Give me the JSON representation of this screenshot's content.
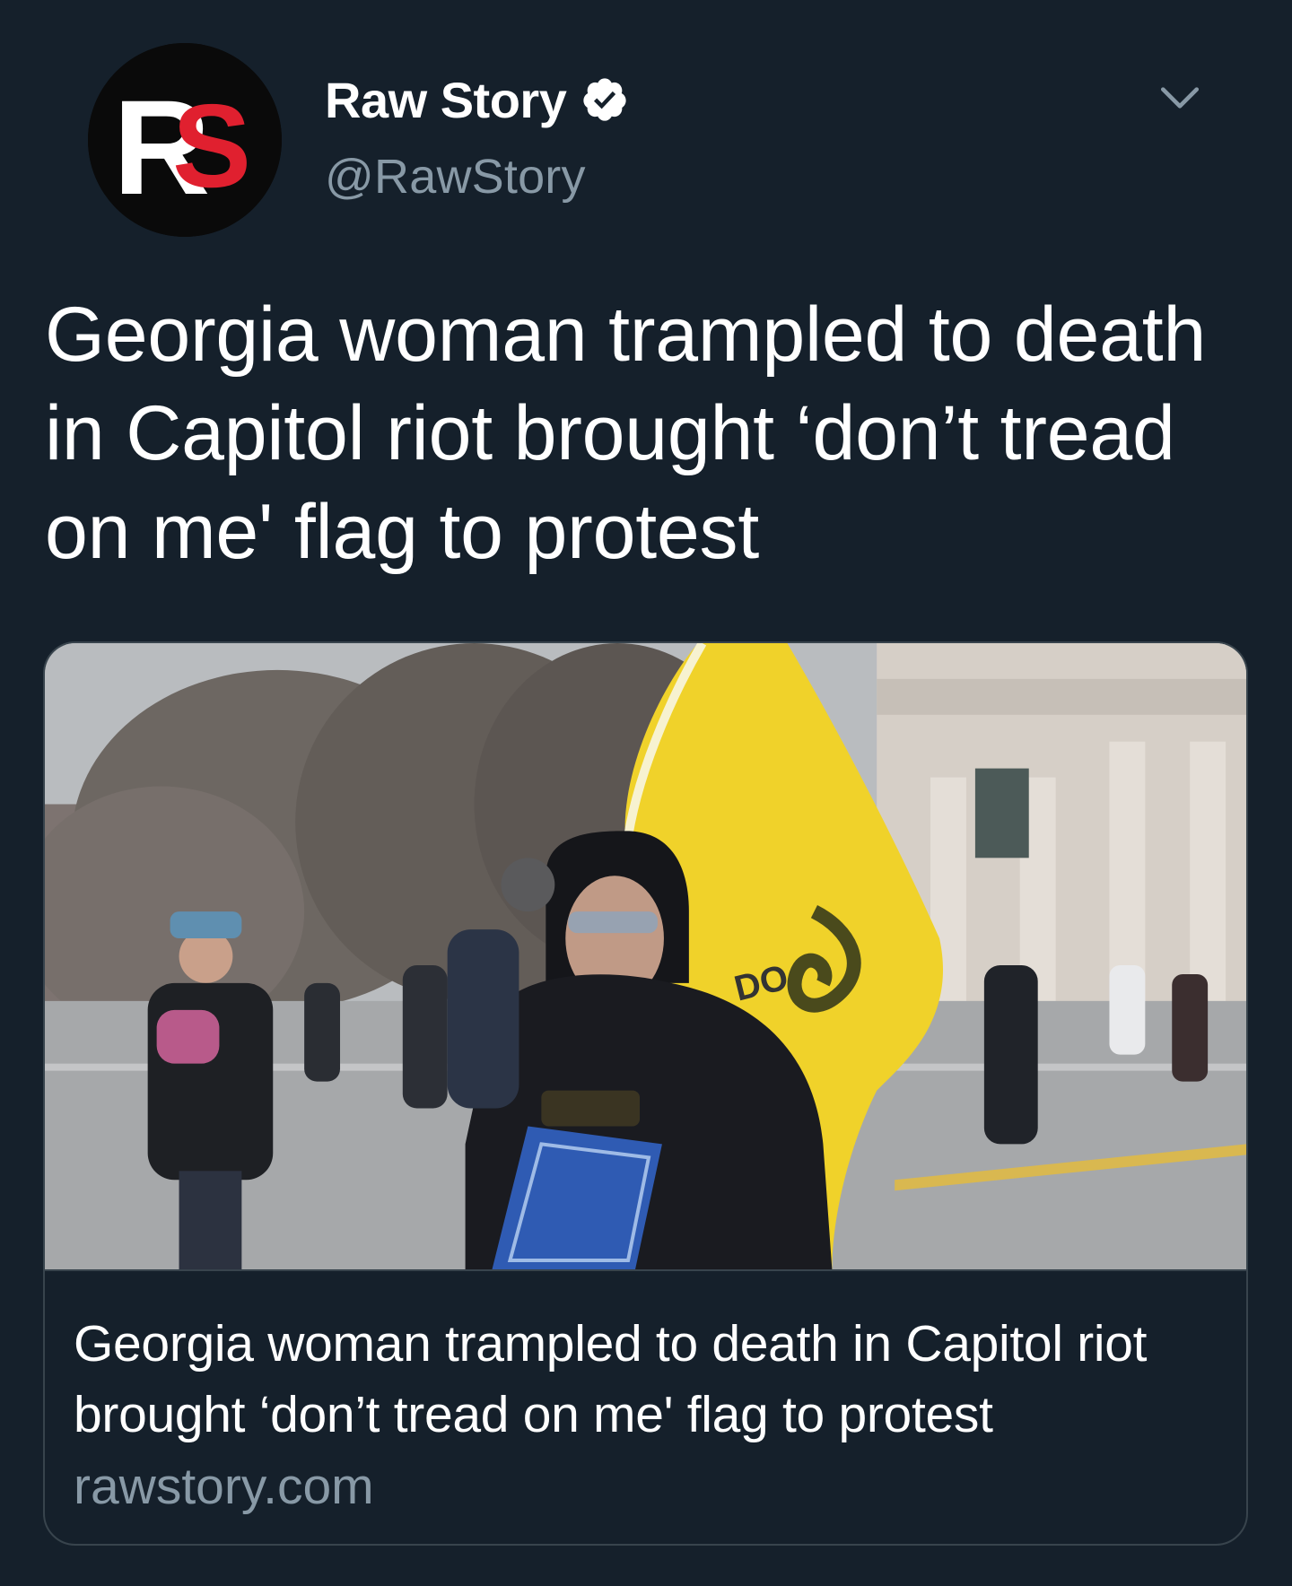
{
  "author": {
    "avatar_text": "RS",
    "display_name": "Raw Story",
    "handle": "@RawStory",
    "verified": true
  },
  "tweet": {
    "text": "Georgia woman trampled to death in Capitol riot brought ‘don’t tread on me' flag to protest"
  },
  "card": {
    "image_sign_text": "DO",
    "title": "Georgia woman trampled to death in Capitol riot brought ‘don’t tread on me' flag to protest",
    "domain": "rawstory.com"
  },
  "icons": {
    "verified": "verified-badge-icon",
    "caret": "chevron-down-icon"
  },
  "colors": {
    "background": "#15202b",
    "text_primary": "#ffffff",
    "text_secondary": "#8899a6",
    "border": "#38444d",
    "brand_red": "#e0202f",
    "flag_yellow": "#f0d22a"
  }
}
